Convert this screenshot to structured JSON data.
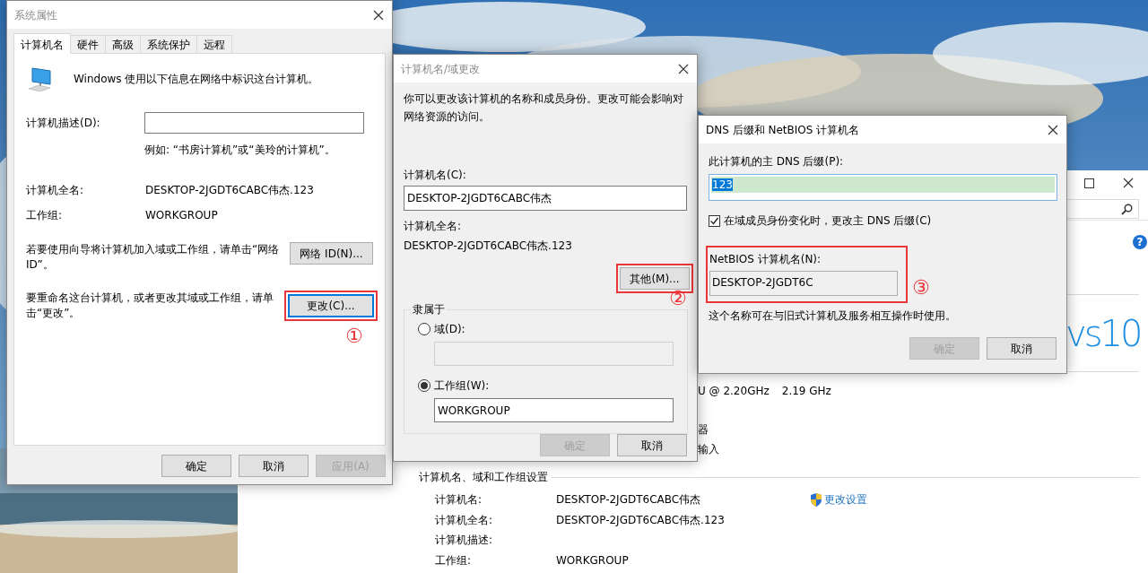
{
  "system_window": {
    "help_glyph": "?",
    "logo_text": "vs10",
    "cpu_text": "U @ 2.20GHz",
    "cpu_speed": "2.19 GHz",
    "partial_texts": [
      "器",
      "输入"
    ],
    "section_title": "计算机名、域和工作组设置",
    "change_settings_link": "更改设置",
    "rows": [
      {
        "label": "计算机名:",
        "value": "DESKTOP-2JGDT6CABC伟杰"
      },
      {
        "label": "计算机全名:",
        "value": "DESKTOP-2JGDT6CABC伟杰.123"
      },
      {
        "label": "计算机描述:"
      },
      {
        "label": "工作组:",
        "value": "WORKGROUP"
      }
    ]
  },
  "system_properties": {
    "title": "系统属性",
    "active": false,
    "tabs": [
      {
        "label": "计算机名",
        "selected": true
      },
      {
        "label": "硬件",
        "selected": false
      },
      {
        "label": "高级",
        "selected": false
      },
      {
        "label": "系统保护",
        "selected": false
      },
      {
        "label": "远程",
        "selected": false
      }
    ],
    "intro": "Windows 使用以下信息在网络中标识这台计算机。",
    "description_label": "计算机描述(D):",
    "description_example": "例如: “书房计算机”或“美玲的计算机”。",
    "full_name_label": "计算机全名:",
    "full_name": "DESKTOP-2JGDT6CABC伟杰.123",
    "workgroup_label": "工作组:",
    "workgroup": "WORKGROUP",
    "network_id_text": "若要使用向导将计算机加入域或工作组，请单击“网络 ID”。",
    "network_id_button": "网络 ID(N)...",
    "rename_text": "要重命名这台计算机，或者更改其域或工作组，请单击“更改”。",
    "change_button": {
      "label": "更改(C)...",
      "highlighted": true
    },
    "annotation": "①",
    "buttons": [
      {
        "label": "确定",
        "disabled": false
      },
      {
        "label": "取消",
        "disabled": false
      },
      {
        "label": "应用(A)",
        "disabled": true
      }
    ]
  },
  "rename_dialog": {
    "title": "计算机名/域更改",
    "active": false,
    "intro": "你可以更改该计算机的名称和成员身份。更改可能会影响对网络资源的访问。",
    "name_label": "计算机名(C):",
    "name_value": "DESKTOP-2JGDT6CABC伟杰",
    "full_name_label": "计算机全名:",
    "full_name": "DESKTOP-2JGDT6CABC伟杰.123",
    "more_button": {
      "label": "其他(M)...",
      "highlighted": true
    },
    "annotation": "②",
    "member_of": {
      "title": "隶属于",
      "options": [
        {
          "label": "域(D):",
          "selected": false
        },
        {
          "label": "工作组(W):",
          "selected": true,
          "value": "WORKGROUP"
        }
      ]
    },
    "buttons": [
      {
        "label": "确定",
        "disabled": true
      },
      {
        "label": "取消",
        "disabled": false
      }
    ]
  },
  "dns_dialog": {
    "title": "DNS 后缀和 NetBIOS 计算机名",
    "active": true,
    "suffix_label": "此计算机的主 DNS 后缀(P):",
    "suffix_value": "123",
    "suffix_selected": true,
    "change_suffix": {
      "label": "在域成员身份变化时，更改主 DNS 后缀(C)",
      "checked": true
    },
    "netbios_label": "NetBIOS 计算机名(N):",
    "netbios_name": "DESKTOP-2JGDT6C",
    "netbios_highlighted": true,
    "annotation": "③",
    "note": "这个名称可在与旧式计算机及服务相互操作时使用。",
    "buttons": [
      {
        "label": "确定",
        "disabled": true
      },
      {
        "label": "取消",
        "disabled": false
      }
    ]
  }
}
